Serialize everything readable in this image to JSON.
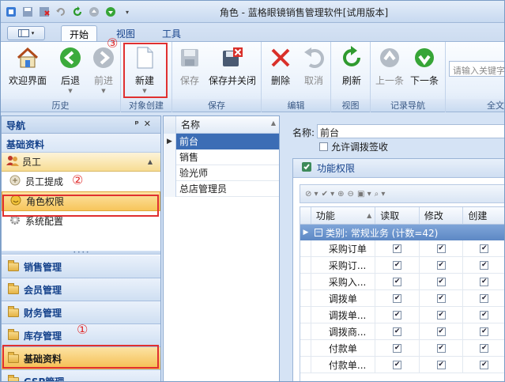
{
  "window": {
    "title": "角色 - 蓝格眼镜销售管理软件[试用版本]"
  },
  "ribbon": {
    "tabs": [
      {
        "label": "开始",
        "active": true
      },
      {
        "label": "视图",
        "active": false
      },
      {
        "label": "工具",
        "active": false
      }
    ],
    "groups": {
      "history": "历史",
      "object_create": "对象创建",
      "save": "保存",
      "edit": "编辑",
      "view": "视图",
      "record_nav": "记录导航",
      "fulltext": "全文"
    },
    "buttons": {
      "welcome": "欢迎界面",
      "back": "后退",
      "forward": "前进",
      "new": "新建",
      "save": "保存",
      "save_close": "保存并关闭",
      "delete": "删除",
      "cancel": "取消",
      "refresh": "刷新",
      "prev": "上一条",
      "next": "下一条"
    },
    "search_placeholder": "请输入关键字"
  },
  "nav": {
    "header": "导航",
    "section_title": "基础资料",
    "group_header": "员工",
    "items": [
      {
        "label": "员工提成"
      },
      {
        "label": "角色权限"
      },
      {
        "label": "系统配置"
      }
    ],
    "bars": [
      {
        "label": "销售管理"
      },
      {
        "label": "会员管理"
      },
      {
        "label": "财务管理"
      },
      {
        "label": "库存管理"
      },
      {
        "label": "基础资料"
      },
      {
        "label": "GSP管理"
      }
    ]
  },
  "role_list": {
    "column": "名称",
    "rows": [
      "前台",
      "销售",
      "验光师",
      "总店管理员"
    ]
  },
  "detail": {
    "name_label": "名称:",
    "name_value": "前台",
    "allow_label": "允许调拨签收",
    "panel_title": "功能权限",
    "columns": [
      "功能",
      "读取",
      "修改",
      "创建"
    ],
    "category": "类别: 常规业务 (计数=42)",
    "rows": [
      "采购订单",
      "采购订...",
      "采购入...",
      "调拨单",
      "调拨单...",
      "调拨商...",
      "付款单",
      "付款单..."
    ]
  },
  "annotations": {
    "one": "①",
    "two": "②",
    "three": "③"
  },
  "colors": {
    "highlight": "#e03030",
    "selection": "#3c6db5",
    "nav_active": "#f7c55a"
  }
}
